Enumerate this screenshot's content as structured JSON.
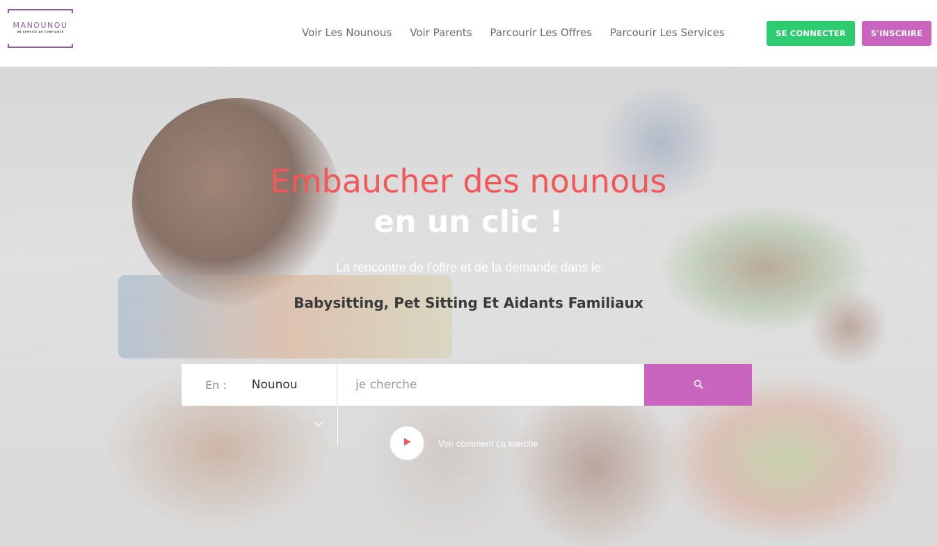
{
  "logo": {
    "brand": "MANOUNOU",
    "tagline": "UN SERVICE DE CONFIANCE"
  },
  "nav": {
    "items": [
      {
        "label": "Voir Les Nounous"
      },
      {
        "label": "Voir Parents"
      },
      {
        "label": "Parcourir Les Offres"
      },
      {
        "label": "Parcourir Les Services"
      }
    ],
    "login_label": "SE CONNECTER",
    "signup_label": "S'INSCRIRE"
  },
  "hero": {
    "headline_1": "Embaucher des nounous",
    "headline_2": "en un clic !",
    "subtitle": "La rencontre de l'offre et de la demande dans le",
    "services": "Babysitting, Pet Sitting Et Aidants Familiaux"
  },
  "search": {
    "category_label": "En :",
    "category_value": "Nounou",
    "placeholder": "je cherche",
    "button_icon": "search-icon"
  },
  "video": {
    "label": "Voir comment ça marche",
    "icon": "play-icon"
  },
  "colors": {
    "accent_red": "#f2575a",
    "brand_purple": "#8e5b9e",
    "signup_pink": "#c965bf",
    "login_green": "#2ecc71"
  }
}
